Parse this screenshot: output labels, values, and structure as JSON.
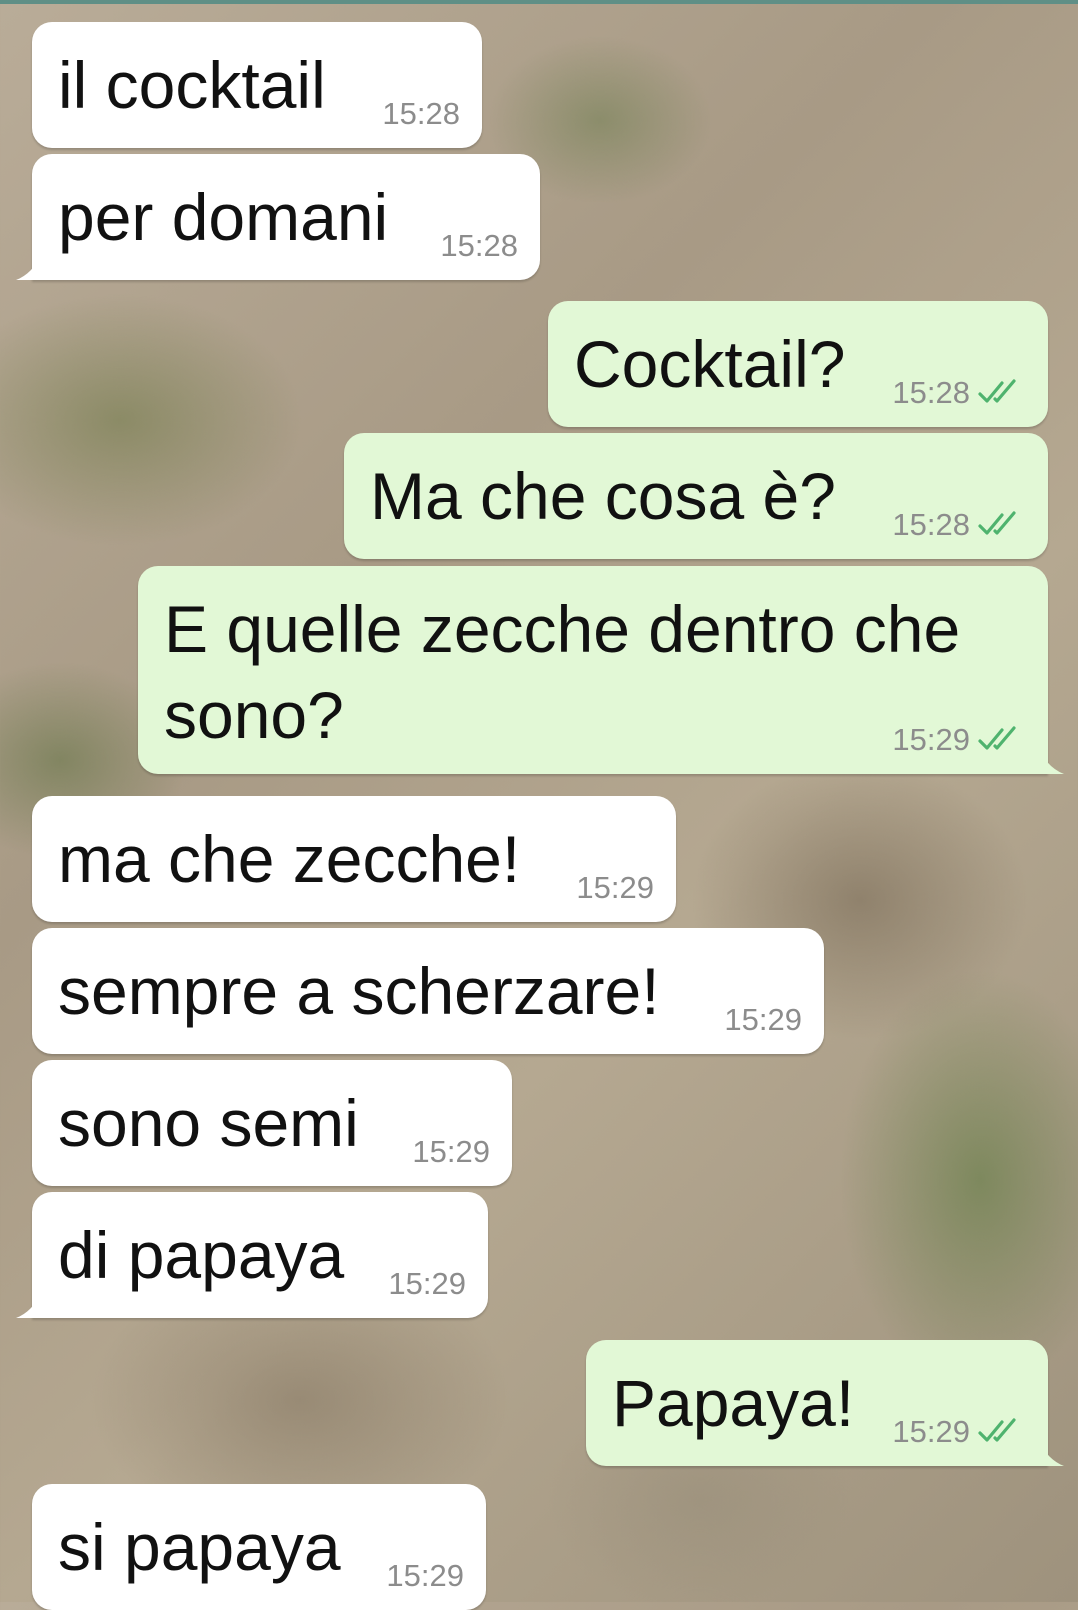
{
  "colors": {
    "incoming_bubble": "#ffffff",
    "outgoing_bubble": "#e2f8d6",
    "timestamp": "#8c8c8c",
    "read_receipt": "#4fb36e"
  },
  "messages": [
    {
      "direction": "incoming",
      "text": "il cocktail",
      "time": "15:28"
    },
    {
      "direction": "incoming",
      "text": "per domani",
      "time": "15:28"
    },
    {
      "direction": "outgoing",
      "text": "Cocktail?",
      "time": "15:28",
      "status_icon": "double-check-icon"
    },
    {
      "direction": "outgoing",
      "text": "Ma che cosa è?",
      "time": "15:28",
      "status_icon": "double-check-icon"
    },
    {
      "direction": "outgoing",
      "text": "E quelle zecche dentro che sono?",
      "time": "15:29",
      "status_icon": "double-check-icon"
    },
    {
      "direction": "incoming",
      "text": "ma che zecche!",
      "time": "15:29"
    },
    {
      "direction": "incoming",
      "text": "sempre a scherzare!",
      "time": "15:29"
    },
    {
      "direction": "incoming",
      "text": "sono semi",
      "time": "15:29"
    },
    {
      "direction": "incoming",
      "text": "di papaya",
      "time": "15:29"
    },
    {
      "direction": "outgoing",
      "text": "Papaya!",
      "time": "15:29",
      "status_icon": "double-check-icon"
    },
    {
      "direction": "incoming",
      "text": "si papaya",
      "time": "15:29"
    }
  ]
}
